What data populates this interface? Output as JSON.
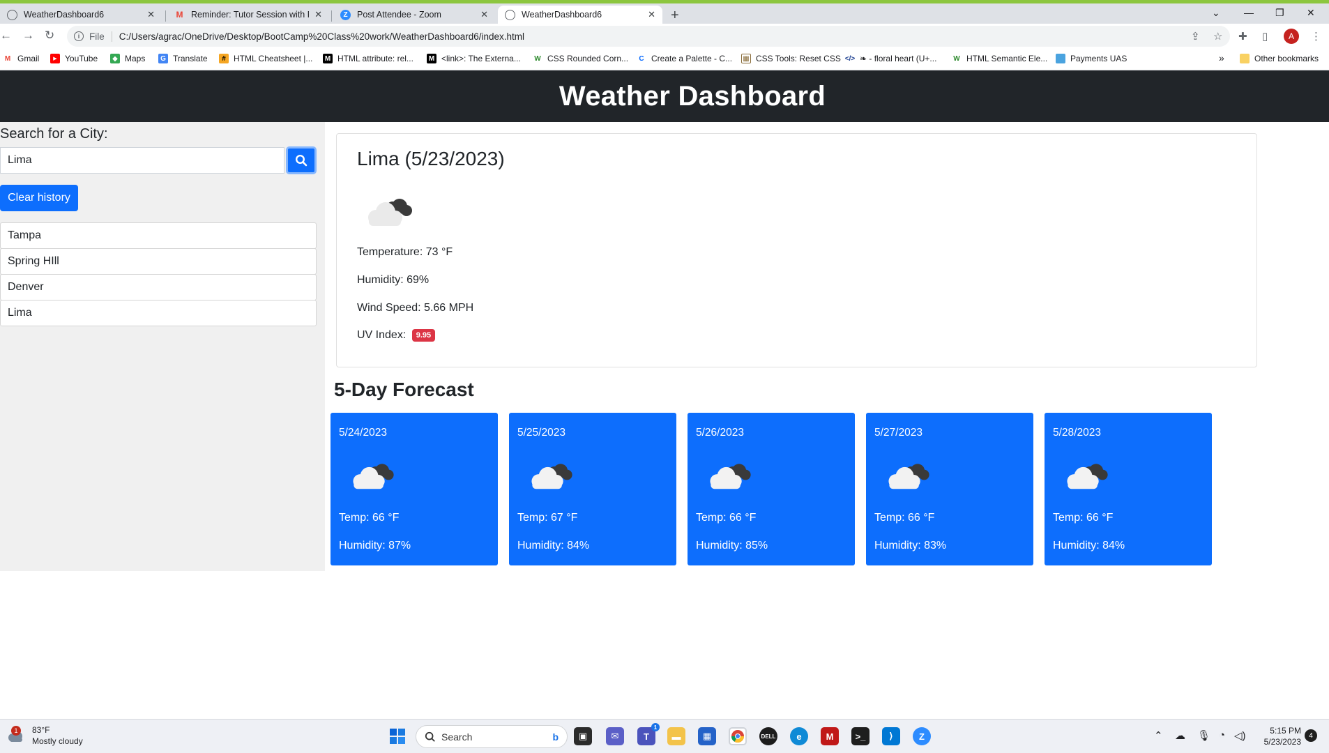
{
  "browser": {
    "tabs": [
      {
        "label": "WeatherDashboard6",
        "active": false
      },
      {
        "label": "Reminder: Tutor Session with Ro",
        "active": false
      },
      {
        "label": "Post Attendee - Zoom",
        "active": false
      },
      {
        "label": "WeatherDashboard6",
        "active": true
      }
    ],
    "address_scheme": "File",
    "address_url": "C:/Users/agrac/OneDrive/Desktop/BootCamp%20Class%20work/WeatherDashboard6/index.html",
    "profile_initial": "A",
    "bookmarks": [
      "Gmail",
      "YouTube",
      "Maps",
      "Translate",
      "HTML Cheatsheet |...",
      "HTML attribute: rel...",
      "<link>: The Externa...",
      "CSS Rounded Corn...",
      "Create a Palette - C...",
      "CSS Tools: Reset CSS",
      "❧ - floral heart (U+...",
      "HTML Semantic Ele...",
      "Payments UAS"
    ],
    "other_bookmarks": "Other bookmarks",
    "bookmarks_overflow": "»"
  },
  "app": {
    "title": "Weather Dashboard",
    "search_label": "Search for a City:",
    "search_value": "Lima",
    "clear_label": "Clear history",
    "history": [
      "Tampa",
      "Spring HIll",
      "Denver",
      "Lima"
    ]
  },
  "current": {
    "city_date": "Lima (5/23/2023)",
    "temperature": "Temperature: 73 °F",
    "humidity": "Humidity: 69%",
    "wind": "Wind Speed: 5.66 MPH",
    "uv_label": "UV Index:",
    "uv_value": "9.95",
    "uv_color": "#dc3545",
    "icon": "cloud-icon"
  },
  "forecast": {
    "title": "5-Day Forecast",
    "days": [
      {
        "date": "5/24/2023",
        "temp": "Temp: 66 °F",
        "humidity": "Humidity: 87%"
      },
      {
        "date": "5/25/2023",
        "temp": "Temp: 67 °F",
        "humidity": "Humidity: 84%"
      },
      {
        "date": "5/26/2023",
        "temp": "Temp: 66 °F",
        "humidity": "Humidity: 85%"
      },
      {
        "date": "5/27/2023",
        "temp": "Temp: 66 °F",
        "humidity": "Humidity: 83%"
      },
      {
        "date": "5/28/2023",
        "temp": "Temp: 66 °F",
        "humidity": "Humidity: 84%"
      }
    ],
    "card_color": "#0d6efd"
  },
  "taskbar": {
    "weather_temp": "83°F",
    "weather_desc": "Mostly cloudy",
    "weather_badge": "1",
    "search_placeholder": "Search",
    "teams_badge": "1",
    "time": "5:15 PM",
    "date": "5/23/2023",
    "notifications": "4"
  }
}
